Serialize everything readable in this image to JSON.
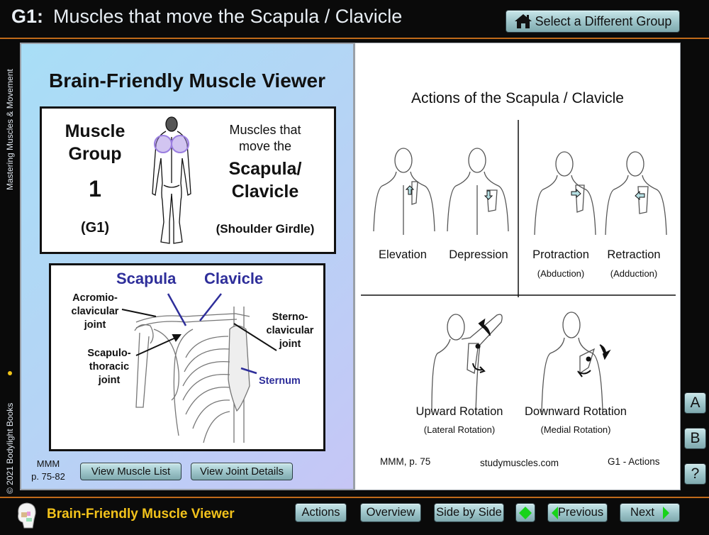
{
  "header": {
    "group_code": "G1:",
    "title": "Muscles that move the Scapula / Clavicle",
    "select_group_button": "Select a Different Group",
    "home_icon": "home-icon"
  },
  "sidebar": {
    "top_text": "Mastering Muscles & Movement",
    "bottom_text": "© 2021 Bodylight Books"
  },
  "left_panel": {
    "heading": "Brain-Friendly Muscle Viewer",
    "group_box": {
      "line1": "Muscle",
      "line2": "Group",
      "number": "1",
      "code": "(G1)",
      "desc_line1": "Muscles that",
      "desc_line2": "move the",
      "desc_bold1": "Scapula/",
      "desc_bold2": "Clavicle",
      "subtitle": "(Shoulder Girdle)",
      "highlight_color": "#9b7fe0"
    },
    "joint_box": {
      "scapula": "Scapula",
      "clavicle": "Clavicle",
      "acromio": [
        "Acromio-",
        "clavicular",
        "joint"
      ],
      "sterno": [
        "Sterno-",
        "clavicular",
        "joint"
      ],
      "scapulo": [
        "Scapulo-",
        "thoracic",
        "joint"
      ],
      "sternum": "Sternum",
      "label_color": "#2e2e9a"
    },
    "reference": [
      "MMM",
      "p. 75-82"
    ],
    "view_muscle_list": "View Muscle List",
    "view_joint_details": "View Joint Details"
  },
  "right_panel": {
    "title": "Actions of the Scapula / Clavicle",
    "actions": [
      {
        "label": "Elevation",
        "sub": ""
      },
      {
        "label": "Depression",
        "sub": ""
      },
      {
        "label": "Protraction",
        "sub": "(Abduction)"
      },
      {
        "label": "Retraction",
        "sub": "(Adduction)"
      },
      {
        "label": "Upward Rotation",
        "sub": "(Lateral Rotation)"
      },
      {
        "label": "Downward Rotation",
        "sub": "(Medial Rotation)"
      }
    ],
    "footer_left": "MMM, p. 75",
    "footer_center": "studymuscles.com",
    "footer_right": "G1 - Actions"
  },
  "side_buttons": [
    "A",
    "B",
    "?"
  ],
  "footer": {
    "title": "Brain-Friendly Muscle Viewer",
    "buttons": {
      "actions": "Actions",
      "overview": "Overview",
      "side_by_side": "Side by Side",
      "previous": "Previous",
      "next": "Next"
    },
    "title_color": "#f2c21b",
    "arrow_color": "#18d31a"
  }
}
